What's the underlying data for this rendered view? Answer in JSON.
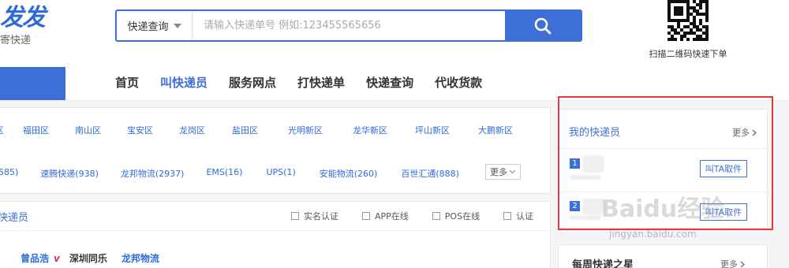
{
  "header": {
    "logo_main": "发发",
    "logo_sub": "寄快递",
    "search": {
      "type_label": "快递查询",
      "placeholder": "请输入快递单号 例如:123455565656"
    },
    "qr_label": "扫描二维码快速下单"
  },
  "nav": {
    "items": [
      "首页",
      "叫快递员",
      "服务网点",
      "打快递单",
      "快递查询",
      "代收货款"
    ],
    "active_index": 1
  },
  "filters": {
    "districts": [
      "区",
      "福田区",
      "南山区",
      "宝安区",
      "龙岗区",
      "盐田区",
      "光明新区",
      "龙华新区",
      "坪山新区",
      "大鹏新区"
    ],
    "companies": [
      "585)",
      "速腾快递(938)",
      "龙邦物流(2937)",
      "EMS(16)",
      "UPS(1)",
      "安能物流(260)",
      "百世汇通(888)"
    ],
    "more_label": "更多"
  },
  "courier_list": {
    "title": "快递员",
    "checks": [
      "实名认证",
      "APP在线",
      "POS在线",
      "认证"
    ],
    "first": {
      "name": "曾品浩",
      "badge": "v",
      "company1": "深圳同乐",
      "company2": "龙邦物流"
    }
  },
  "my_couriers": {
    "title": "我的快递员",
    "more_label": "更多",
    "items": [
      {
        "rank": "1",
        "button": "叫TA取件"
      },
      {
        "rank": "2",
        "button": "叫TA取件"
      }
    ]
  },
  "weekly_star": {
    "title": "每周快递之星",
    "more_label": "更多"
  },
  "watermark": {
    "text": "Baidu经验",
    "url": "jingyan.baidu.com"
  },
  "colors": {
    "brand_blue": "#3e6fd8",
    "link_blue": "#2f6bd8",
    "highlight_red": "#e43a3a"
  }
}
